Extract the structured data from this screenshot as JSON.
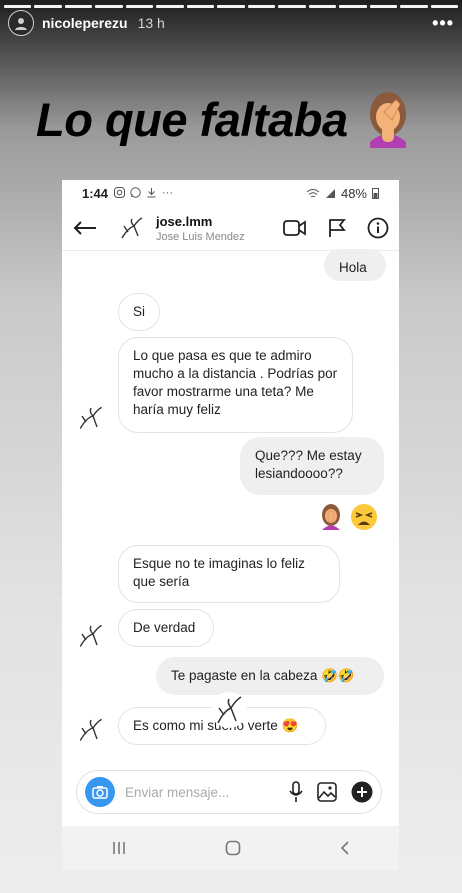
{
  "story": {
    "username": "nicoleperezu",
    "time_ago": "13 h",
    "segments": 15,
    "headline": "Lo que faltaba",
    "headline_emoji_icon": "face-palm-woman-icon"
  },
  "phone_status": {
    "time": "1:44",
    "battery": "48%",
    "left_icons": [
      "instagram-icon",
      "whatsapp-icon",
      "download-icon",
      "more-dots-icon"
    ],
    "right_icons": [
      "wifi-icon",
      "signal-icon",
      "battery-icon"
    ]
  },
  "dm_header": {
    "handle": "jose.lmm",
    "full_name": "Jose Luis Mendez"
  },
  "messages": [
    {
      "from": "me",
      "text": "Hola"
    },
    {
      "from": "them",
      "text": "Si"
    },
    {
      "from": "them",
      "text": "Lo que pasa es que te admiro mucho a la distancia . Podrías por favor mostrarme una teta? Me haría muy feliz"
    },
    {
      "from": "me",
      "text": "Que??? Me estay lesiandoooo??"
    },
    {
      "from": "me",
      "emojis": [
        "face-palm-woman-icon",
        "tired-face-icon"
      ]
    },
    {
      "from": "them",
      "text": "Esque no te imaginas lo feliz que sería"
    },
    {
      "from": "them",
      "text": "De verdad"
    },
    {
      "from": "me",
      "text": "Te pagaste en la cabeza 🤣🤣"
    },
    {
      "from": "them",
      "text": "Es como mi sueño verte 😍"
    }
  ],
  "composer": {
    "placeholder": "Enviar mensaje..."
  },
  "colors": {
    "accent_blue": "#3897f0",
    "my_bubble": "#efefef",
    "their_bubble_border": "#e3e3e3"
  }
}
